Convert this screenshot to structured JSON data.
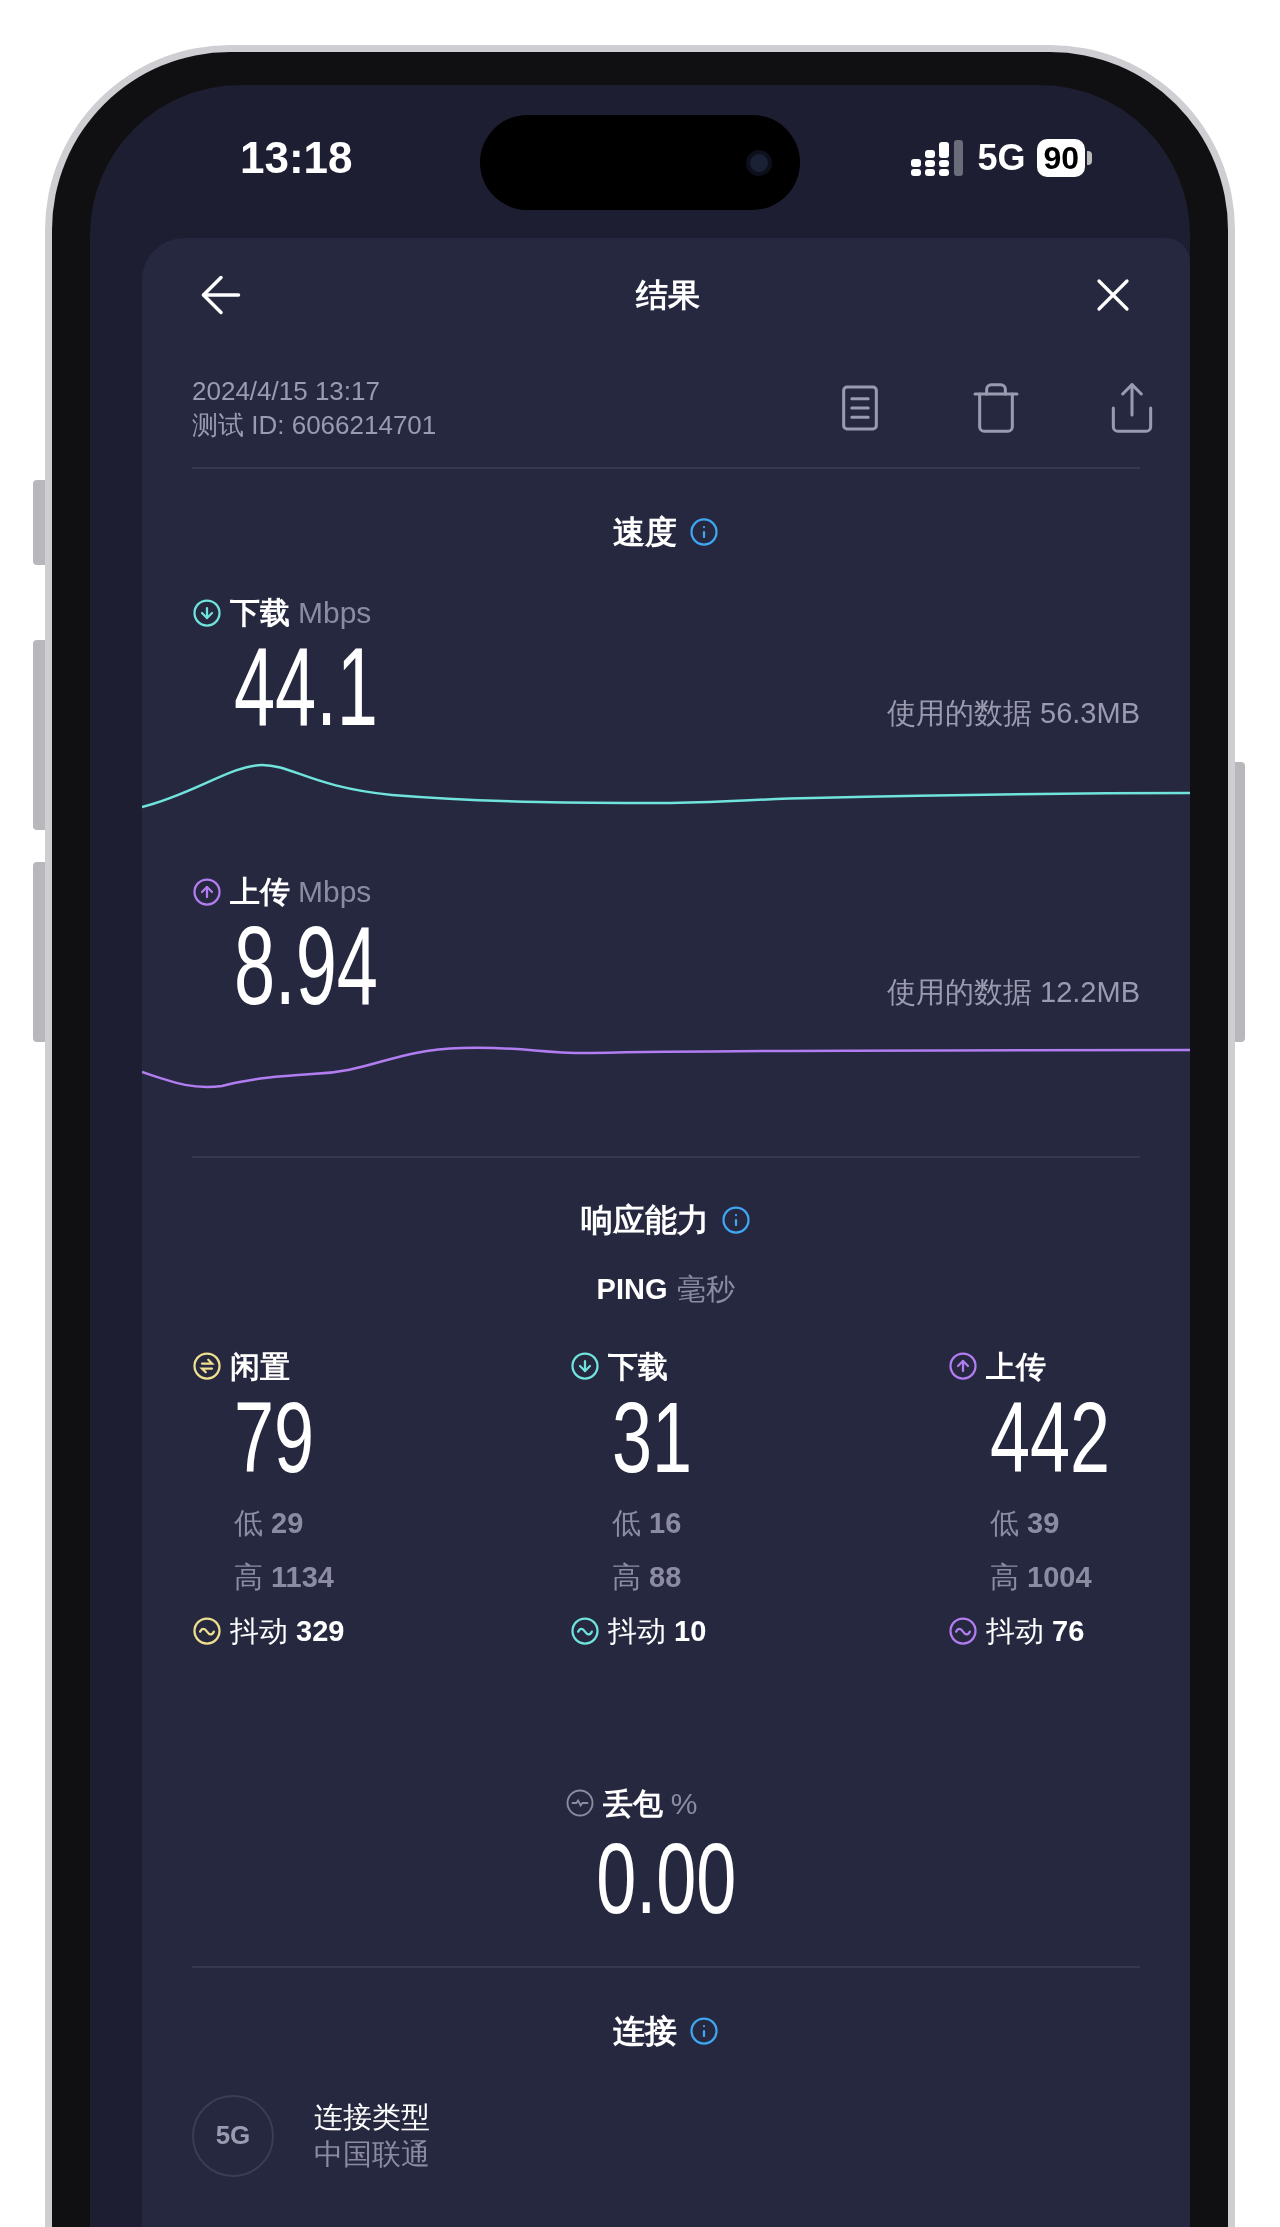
{
  "status_bar": {
    "time": "13:18",
    "network": "5G",
    "battery": "90"
  },
  "header": {
    "title": "结果"
  },
  "test_info": {
    "date": "2024/4/15 13:17",
    "test_id": "测试 ID: 6066214701"
  },
  "speed": {
    "title": "速度",
    "metrics": [
      {
        "kind": "download",
        "label": "下载",
        "unit": "Mbps",
        "value": "44.1",
        "data_used": "使用的数据 56.3MB"
      },
      {
        "kind": "upload",
        "label": "上传",
        "unit": "Mbps",
        "value": "8.94",
        "data_used": "使用的数据 12.2MB"
      }
    ]
  },
  "responsiveness": {
    "title": "响应能力",
    "ping_label": "PING",
    "ping_unit": "毫秒",
    "columns": [
      {
        "kind": "idle",
        "label": "闲置",
        "value": "79",
        "low": "低 **29**",
        "high": "高 **1134**",
        "jitter": "抖动 **329**"
      },
      {
        "kind": "download",
        "label": "下载",
        "value": "31",
        "low": "低 **16**",
        "high": "高 **88**",
        "jitter": "抖动 **10**"
      },
      {
        "kind": "upload",
        "label": "上传",
        "value": "442",
        "low": "低 **39**",
        "high": "高 **1004**",
        "jitter": "抖动 **76**"
      }
    ]
  },
  "packet_loss": {
    "label": "丢包",
    "unit": "%",
    "value": "0.00"
  },
  "connection": {
    "title": "连接",
    "badge": "5G",
    "type_label": "连接类型",
    "provider": "中国联通"
  }
}
